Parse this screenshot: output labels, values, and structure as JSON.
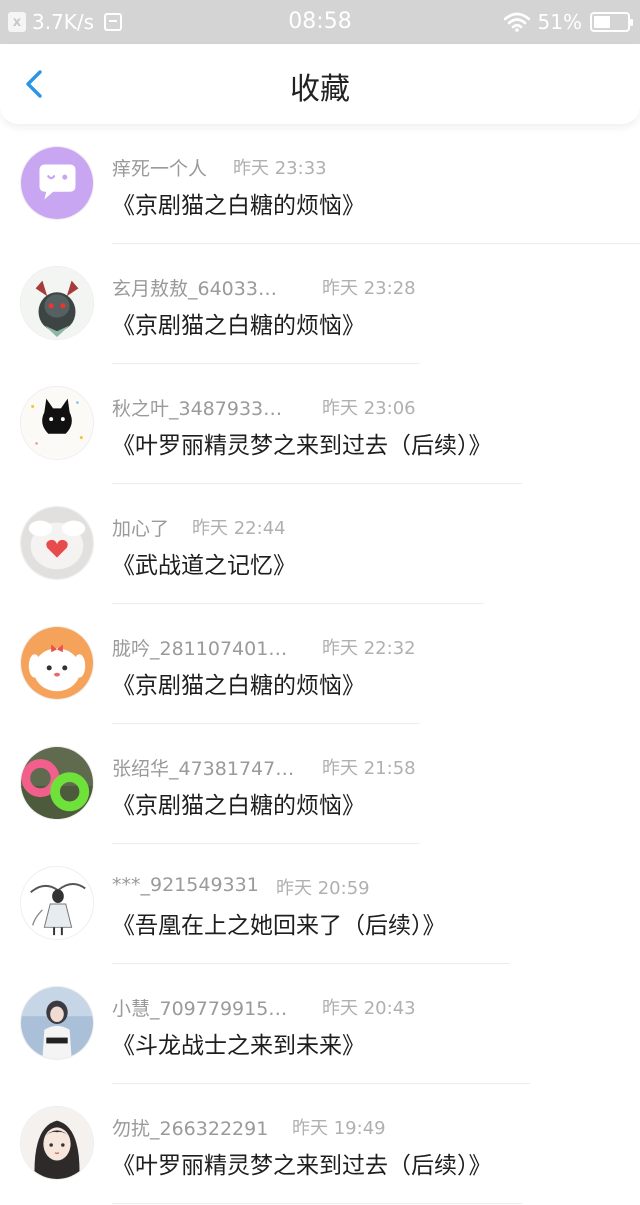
{
  "status_bar": {
    "speed": "3.7K/s",
    "time": "08:58",
    "battery": "51%",
    "battery_level": 0.51
  },
  "header": {
    "title": "收藏"
  },
  "favorites": [
    {
      "name": "痒死一个人",
      "time": "昨天 23:33",
      "title": "《京剧猫之白糖的烦恼》"
    },
    {
      "name": "玄月敖敖_64033…",
      "time": "昨天 23:28",
      "title": "《京剧猫之白糖的烦恼》"
    },
    {
      "name": "秋之叶_3487933…",
      "time": "昨天 23:06",
      "title": "《叶罗丽精灵梦之来到过去（后续）》"
    },
    {
      "name": "加心了",
      "time": "昨天 22:44",
      "title": "《武战道之记忆》"
    },
    {
      "name": "胧吟_281107401…",
      "time": "昨天 22:32",
      "title": "《京剧猫之白糖的烦恼》"
    },
    {
      "name": "张绍华_47381747…",
      "time": "昨天 21:58",
      "title": "《京剧猫之白糖的烦恼》"
    },
    {
      "name": "***_921549331",
      "time": "昨天 20:59",
      "title": "《吾凰在上之她回来了（后续）》"
    },
    {
      "name": "小慧_709779915…",
      "time": "昨天 20:43",
      "title": "《斗龙战士之来到未来》"
    },
    {
      "name": "勿扰_266322291",
      "time": "昨天 19:49",
      "title": "《叶罗丽精灵梦之来到过去（后续）》"
    }
  ]
}
